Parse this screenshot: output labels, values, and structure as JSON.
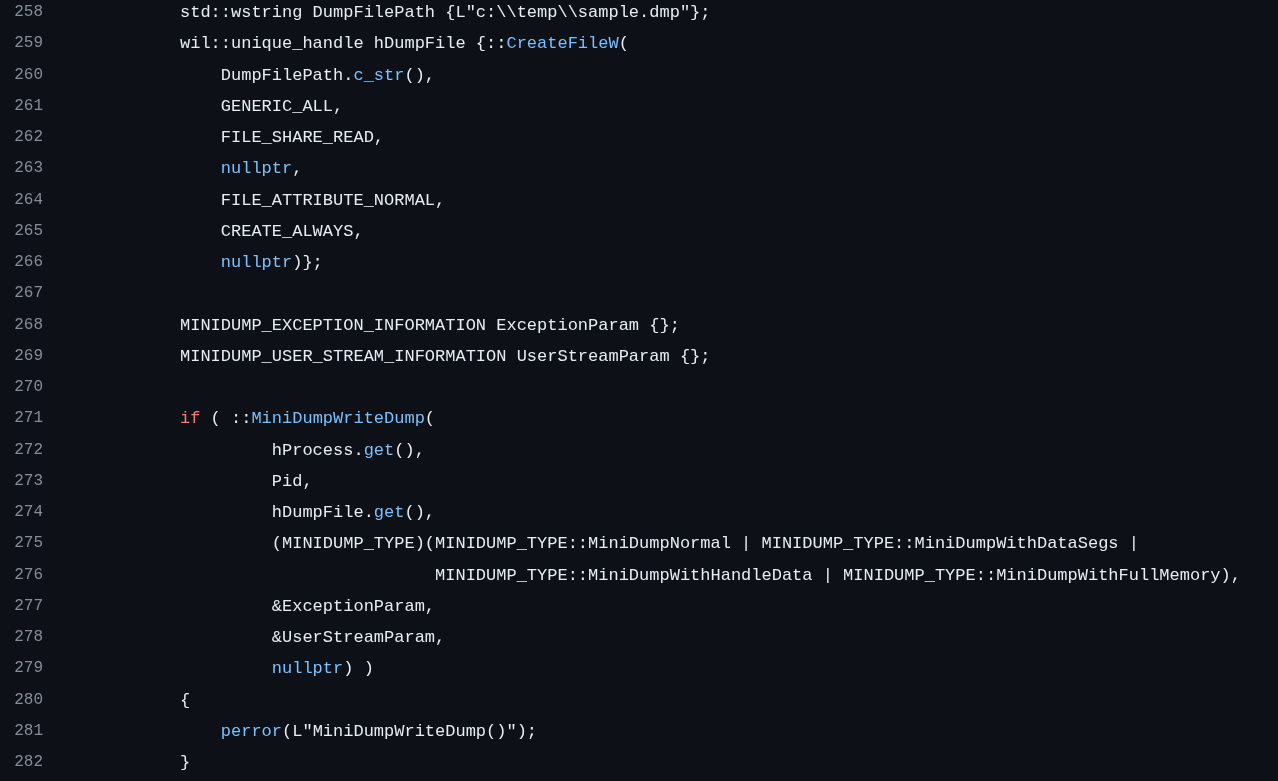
{
  "code_lines": [
    {
      "number": "258",
      "tokens": [
        {
          "kind": "plain",
          "text": "std::wstring DumpFilePath {L\"c:\\\\temp\\\\sample.dmp\"};"
        }
      ]
    },
    {
      "number": "259",
      "tokens": [
        {
          "kind": "plain",
          "text": "wil::unique_handle hDumpFile {::"
        },
        {
          "kind": "function",
          "text": "CreateFileW"
        },
        {
          "kind": "plain",
          "text": "("
        }
      ]
    },
    {
      "number": "260",
      "tokens": [
        {
          "kind": "plain",
          "text": "    DumpFilePath."
        },
        {
          "kind": "function",
          "text": "c_str"
        },
        {
          "kind": "plain",
          "text": "(),"
        }
      ]
    },
    {
      "number": "261",
      "tokens": [
        {
          "kind": "plain",
          "text": "    GENERIC_ALL,"
        }
      ]
    },
    {
      "number": "262",
      "tokens": [
        {
          "kind": "plain",
          "text": "    FILE_SHARE_READ,"
        }
      ]
    },
    {
      "number": "263",
      "tokens": [
        {
          "kind": "function",
          "text": "    nullptr"
        },
        {
          "kind": "plain",
          "text": ","
        }
      ]
    },
    {
      "number": "264",
      "tokens": [
        {
          "kind": "plain",
          "text": "    FILE_ATTRIBUTE_NORMAL,"
        }
      ]
    },
    {
      "number": "265",
      "tokens": [
        {
          "kind": "plain",
          "text": "    CREATE_ALWAYS,"
        }
      ]
    },
    {
      "number": "266",
      "tokens": [
        {
          "kind": "function",
          "text": "    nullptr"
        },
        {
          "kind": "plain",
          "text": ")};"
        }
      ]
    },
    {
      "number": "267"
    },
    {
      "number": "268",
      "tokens": [
        {
          "kind": "plain",
          "text": "MINIDUMP_EXCEPTION_INFORMATION ExceptionParam {};"
        }
      ]
    },
    {
      "number": "269",
      "tokens": [
        {
          "kind": "plain",
          "text": "MINIDUMP_USER_STREAM_INFORMATION UserStreamParam {};"
        }
      ]
    },
    {
      "number": "270"
    },
    {
      "number": "271",
      "tokens": [
        {
          "kind": "keyword",
          "text": "if"
        },
        {
          "kind": "plain",
          "text": " ( ::"
        },
        {
          "kind": "function",
          "text": "MiniDumpWriteDump"
        },
        {
          "kind": "plain",
          "text": "("
        }
      ]
    },
    {
      "number": "272",
      "tokens": [
        {
          "kind": "plain",
          "text": "         hProcess."
        },
        {
          "kind": "function",
          "text": "get"
        },
        {
          "kind": "plain",
          "text": "(),"
        }
      ]
    },
    {
      "number": "273",
      "tokens": [
        {
          "kind": "plain",
          "text": "         Pid,"
        }
      ]
    },
    {
      "number": "274",
      "tokens": [
        {
          "kind": "plain",
          "text": "         hDumpFile."
        },
        {
          "kind": "function",
          "text": "get"
        },
        {
          "kind": "plain",
          "text": "(),"
        }
      ]
    },
    {
      "number": "275",
      "tokens": [
        {
          "kind": "plain",
          "text": "         (MINIDUMP_TYPE)(MINIDUMP_TYPE::MiniDumpNormal | MINIDUMP_TYPE::MiniDumpWithDataSegs |"
        }
      ]
    },
    {
      "number": "276",
      "tokens": [
        {
          "kind": "plain",
          "text": "                         MINIDUMP_TYPE::MiniDumpWithHandleData | MINIDUMP_TYPE::MiniDumpWithFullMemory),"
        }
      ]
    },
    {
      "number": "277",
      "tokens": [
        {
          "kind": "plain",
          "text": "         &ExceptionParam,"
        }
      ]
    },
    {
      "number": "278",
      "tokens": [
        {
          "kind": "plain",
          "text": "         &UserStreamParam,"
        }
      ]
    },
    {
      "number": "279",
      "tokens": [
        {
          "kind": "function",
          "text": "         nullptr"
        },
        {
          "kind": "plain",
          "text": ") )"
        }
      ]
    },
    {
      "number": "280",
      "tokens": [
        {
          "kind": "plain",
          "text": "{"
        }
      ]
    },
    {
      "number": "281",
      "tokens": [
        {
          "kind": "function",
          "text": "    perror"
        },
        {
          "kind": "plain",
          "text": "(L\"MiniDumpWriteDump()\");"
        }
      ]
    },
    {
      "number": "282",
      "tokens": [
        {
          "kind": "plain",
          "text": "}"
        }
      ]
    }
  ]
}
